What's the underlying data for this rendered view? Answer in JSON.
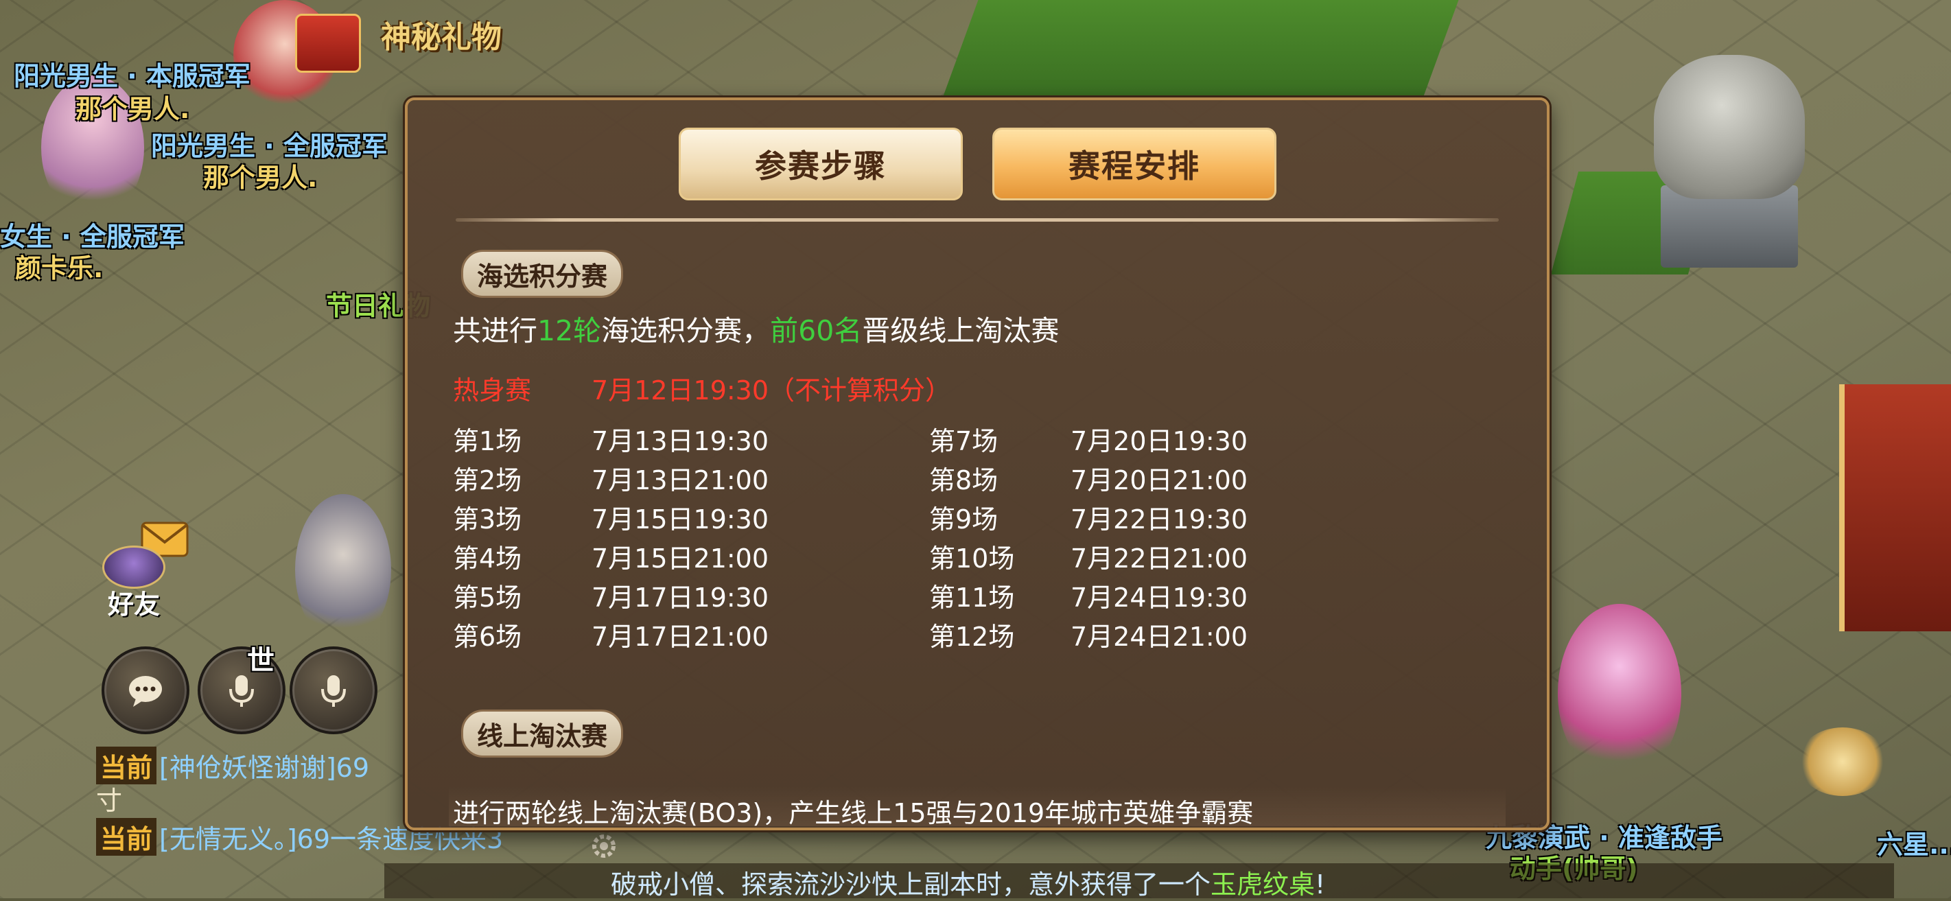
{
  "world": {
    "labels": [
      {
        "id": "top-left-1",
        "text": "阳光男生 · 本服冠军"
      },
      {
        "id": "top-left-2",
        "text": "那个男人."
      },
      {
        "id": "mid-left-1",
        "text": "阳光男生 · 全服冠军"
      },
      {
        "id": "mid-left-2",
        "text": "那个男人."
      },
      {
        "id": "left-3",
        "text": "女生 · 全服冠军"
      },
      {
        "id": "left-4",
        "text": "颜卡乐."
      },
      {
        "id": "festival",
        "text": "节日礼物"
      },
      {
        "id": "right-1",
        "text": "九黎演武 · 准逢敌手"
      },
      {
        "id": "right-2",
        "text": "动手(帅哥)"
      },
      {
        "id": "right-3",
        "text": "六星..."
      }
    ],
    "mystery_gift": "神秘礼物"
  },
  "hud": {
    "friends_label": "好友",
    "world_char": "世",
    "chat_lines": [
      {
        "tag": "当前",
        "text": "[神伧妖怪谢谢]69",
        "cont": "寸"
      },
      {
        "tag": "当前",
        "text": "[无情无义。]69一条速度快来3"
      }
    ],
    "ticker": {
      "pre": "破戒小僧、探索流沙沙快上副本时，意外获得了一个",
      "item": "玉虎纹桌",
      "post": "!"
    }
  },
  "modal": {
    "tabs": {
      "steps": "参赛步骤",
      "schedule": "赛程安排"
    },
    "section_a": {
      "title": "海选积分赛",
      "intro_pre": "共进行",
      "intro_rounds": "12轮",
      "intro_mid": "海选积分赛，",
      "intro_top": "前60名",
      "intro_post": "晋级线上淘汰赛",
      "warmup": {
        "label": "热身赛",
        "time": "7月12日19:30（不计算积分）"
      },
      "rounds_left": [
        {
          "label": "第1场",
          "time": "7月13日19:30"
        },
        {
          "label": "第2场",
          "time": "7月13日21:00"
        },
        {
          "label": "第3场",
          "time": "7月15日19:30"
        },
        {
          "label": "第4场",
          "time": "7月15日21:00"
        },
        {
          "label": "第5场",
          "time": "7月17日19:30"
        },
        {
          "label": "第6场",
          "time": "7月17日21:00"
        }
      ],
      "rounds_right": [
        {
          "label": "第7场",
          "time": "7月20日19:30"
        },
        {
          "label": "第8场",
          "time": "7月20日21:00"
        },
        {
          "label": "第9场",
          "time": "7月22日19:30"
        },
        {
          "label": "第10场",
          "time": "7月22日21:00"
        },
        {
          "label": "第11场",
          "time": "7月24日19:30"
        },
        {
          "label": "第12场",
          "time": "7月24日21:00"
        }
      ]
    },
    "section_b": {
      "title": "线上淘汰赛",
      "desc": "进行两轮线上淘汰赛(BO3)，产生线上15强与2019年城市英雄争霸赛"
    }
  },
  "colors": {
    "accent_green": "#3fcf3f",
    "warmup_red": "#ff3a2a",
    "modal_bg": "#58422f",
    "modal_border": "#b88b4f"
  }
}
